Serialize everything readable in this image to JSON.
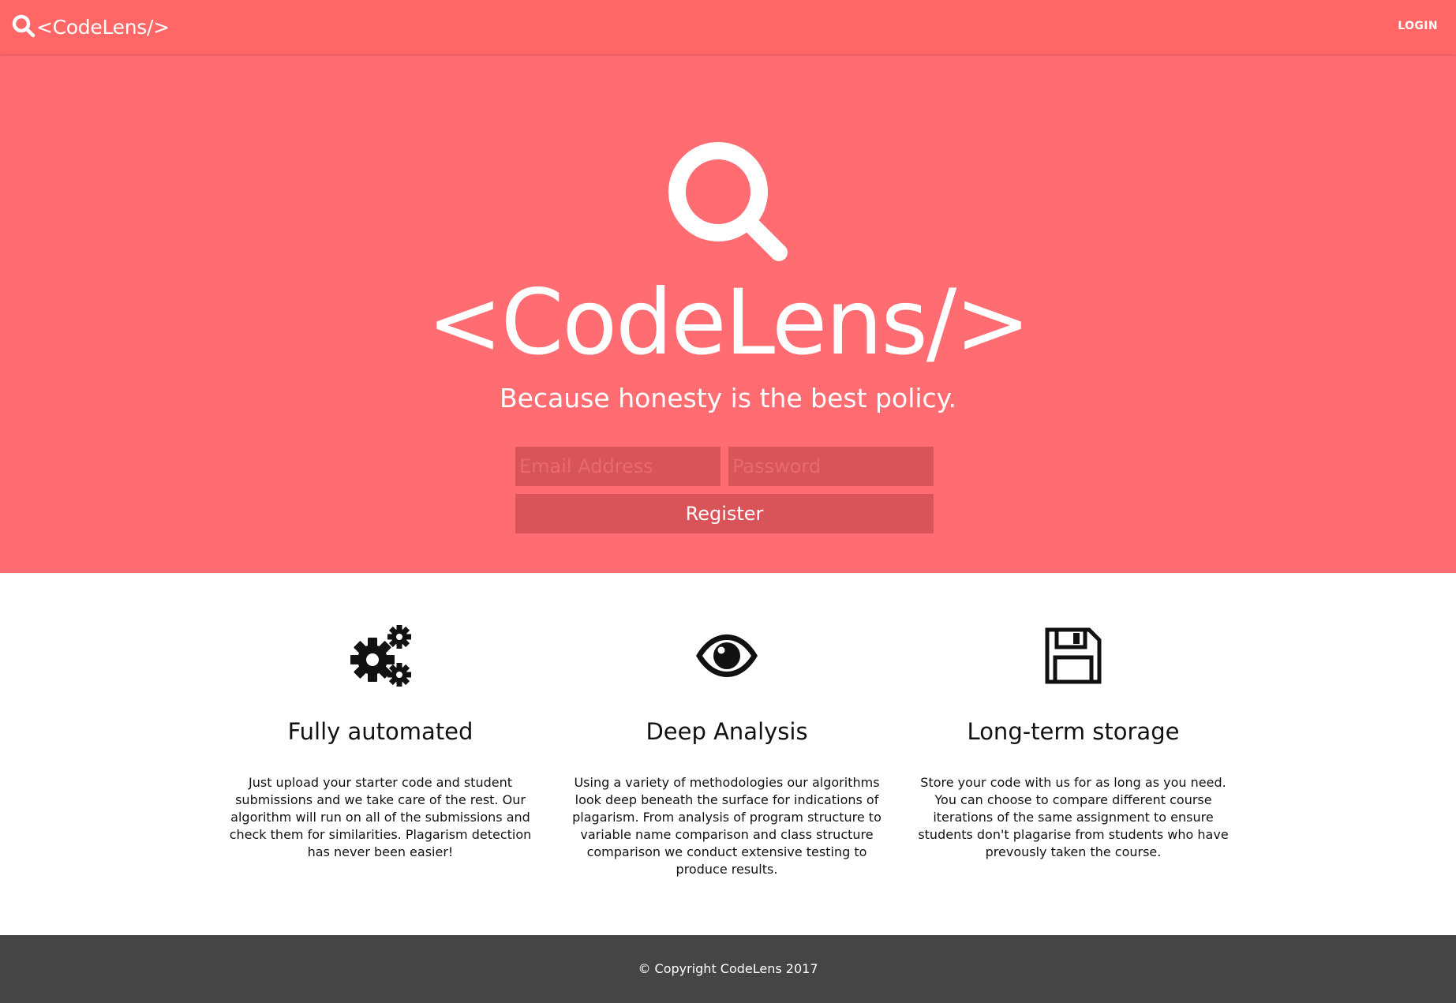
{
  "nav": {
    "brand_text": "<CodeLens/>",
    "brand_icon": "search-icon",
    "login_label": "LOGIN"
  },
  "hero": {
    "icon": "search-icon",
    "title": "<CodeLens/>",
    "tagline": "Because honesty is the best policy.",
    "email_placeholder": "Email Address",
    "email_value": "",
    "password_placeholder": "Password",
    "password_value": "",
    "register_label": "Register"
  },
  "features": [
    {
      "icon": "gears-icon",
      "title": "Fully automated",
      "text": "Just upload your starter code and student submissions and we take care of the rest. Our algorithm will run on all of the submissions and check them for similarities. Plagarism detection has never been easier!"
    },
    {
      "icon": "eye-icon",
      "title": "Deep Analysis",
      "text": "Using a variety of methodologies our algorithms look deep beneath the surface for indications of plagarism. From analysis of program structure to variable name comparison and class structure comparison we conduct extensive testing to produce results."
    },
    {
      "icon": "save-icon",
      "title": "Long-term storage",
      "text": "Store your code with us for as long as you need. You can choose to compare different course iterations of the same assignment to ensure students don't plagarise from students who have prevously taken the course."
    }
  ],
  "footer": {
    "copyright": "© Copyright CodeLens 2017"
  },
  "colors": {
    "navbar": "#ff6666",
    "hero": "#ff6c71",
    "form_fields": "#d95459",
    "footer": "#454545",
    "text_light": "#ffffff",
    "text_dark": "#111111"
  }
}
